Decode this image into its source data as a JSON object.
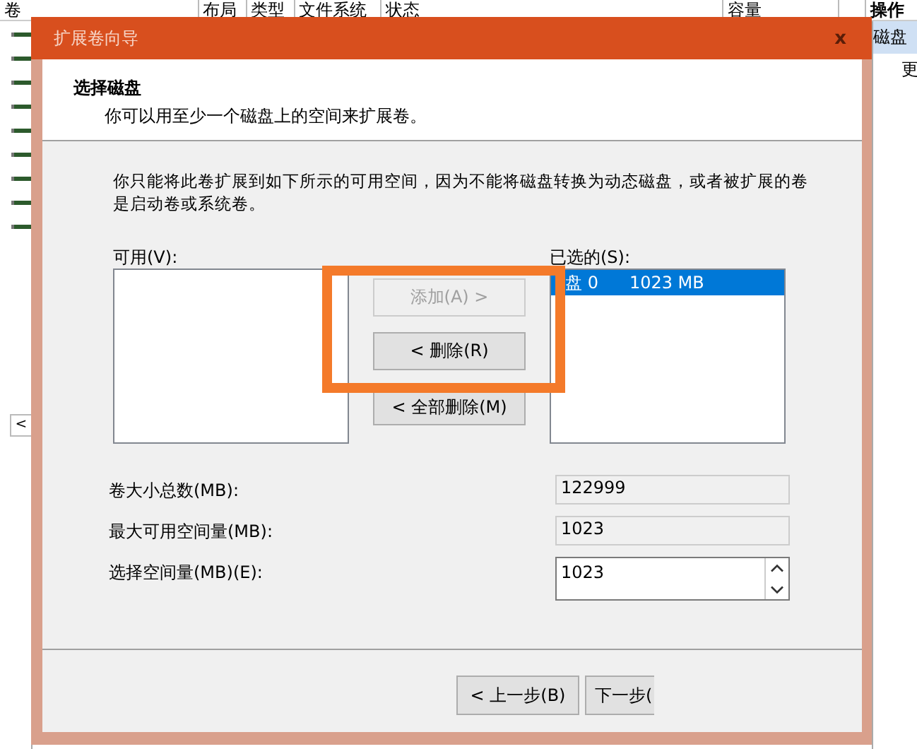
{
  "background": {
    "columns": [
      "卷",
      "布局",
      "类型",
      "文件系统",
      "状态",
      "容量"
    ],
    "actions_header": "操作",
    "actions": [
      {
        "label": "磁盘",
        "selected": true
      },
      {
        "label": "更",
        "selected": false
      }
    ],
    "scroll_left": "<"
  },
  "dialog": {
    "title": "扩展卷向导",
    "close": "x",
    "heading": "选择磁盘",
    "subheading": "你可以用至少一个磁盘上的空间来扩展卷。",
    "intro": "你只能将此卷扩展到如下所示的可用空间，因为不能将磁盘转换为动态磁盘，或者被扩展的卷是启动卷或系统卷。",
    "available_label": "可用(V):",
    "selected_label": "已选的(S):",
    "selected_items": [
      {
        "disk": "盘 0",
        "size": "1023 MB",
        "selected": true
      }
    ],
    "buttons": [
      {
        "label": "添加(A) >",
        "disabled": true
      },
      {
        "label": "< 删除(R)",
        "disabled": false
      },
      {
        "label": "< 全部删除(M)",
        "disabled": false
      }
    ],
    "fields": [
      {
        "label": "卷大小总数(MB):",
        "value": "122999",
        "kind": "readonly"
      },
      {
        "label": "最大可用空间量(MB):",
        "value": "1023",
        "kind": "readonly"
      },
      {
        "label": "选择空间量(MB)(E):",
        "value": "1023",
        "kind": "spinner"
      }
    ],
    "footer_buttons": [
      "< 上一步(B)",
      "下一步("
    ]
  }
}
